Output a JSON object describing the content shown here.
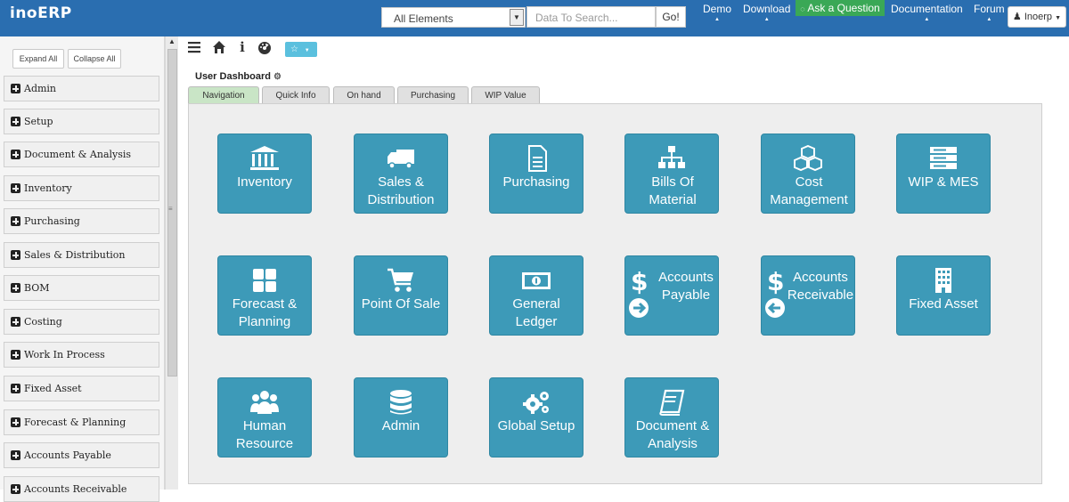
{
  "header": {
    "brand": "inoERP",
    "search_select": "All Elements",
    "search_placeholder": "Data To Search...",
    "go_label": "Go!",
    "nav": [
      "Demo",
      "Download",
      "Ask a Question",
      "Documentation",
      "Forum"
    ],
    "user": "Inoerp"
  },
  "sidebar": {
    "expand_all": "Expand All",
    "collapse_all": "Collapse All",
    "items": [
      "Admin",
      "Setup",
      "Document & Analysis",
      "Inventory",
      "Purchasing",
      "Sales & Distribution",
      "BOM",
      "Costing",
      "Work In Process",
      "Fixed Asset",
      "Forecast & Planning",
      "Accounts Payable",
      "Accounts Receivable"
    ]
  },
  "dashboard": {
    "title": "User Dashboard",
    "tabs": [
      "Navigation",
      "Quick Info",
      "On hand",
      "Purchasing",
      "WIP Value"
    ],
    "tiles": [
      {
        "icon": "bank-icon",
        "label": "Inventory"
      },
      {
        "icon": "truck-icon",
        "label": "Sales & Distribution"
      },
      {
        "icon": "document-icon",
        "label": "Purchasing"
      },
      {
        "icon": "sitemap-icon",
        "label": "Bills Of Material"
      },
      {
        "icon": "cubes-icon",
        "label": "Cost Management"
      },
      {
        "icon": "server-icon",
        "label": "WIP & MES"
      },
      {
        "icon": "grid-icon",
        "label": "Forecast & Planning"
      },
      {
        "icon": "cart-icon",
        "label": "Point Of Sale"
      },
      {
        "icon": "money-icon",
        "label": "General Ledger"
      },
      {
        "icon": "dollar-arrow-right-icon",
        "label": "Accounts Payable"
      },
      {
        "icon": "dollar-arrow-left-icon",
        "label": "Accounts Receivable"
      },
      {
        "icon": "building-icon",
        "label": "Fixed Asset"
      },
      {
        "icon": "users-icon",
        "label": "Human Resource"
      },
      {
        "icon": "database-icon",
        "label": "Admin"
      },
      {
        "icon": "gears-icon",
        "label": "Global Setup"
      },
      {
        "icon": "book-icon",
        "label": "Document & Analysis"
      }
    ]
  },
  "colors": {
    "header": "#2a6eb0",
    "tile": "#3d9ab8",
    "ask": "#3aa856",
    "active_tab": "#c9e5c6"
  }
}
